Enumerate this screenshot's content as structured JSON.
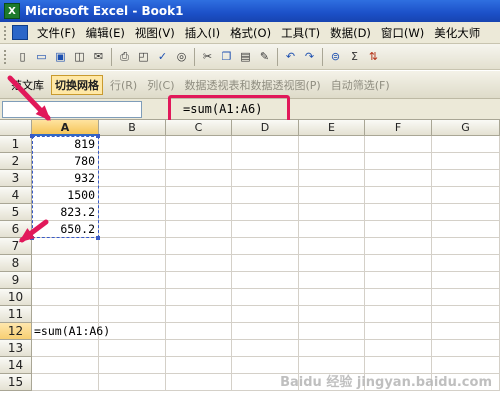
{
  "window": {
    "title": "Microsoft Excel - Book1",
    "app_icon": "X"
  },
  "menubar": {
    "items": [
      "文件(F)",
      "编辑(E)",
      "视图(V)",
      "插入(I)",
      "格式(O)",
      "工具(T)",
      "数据(D)",
      "窗口(W)",
      "美化大师"
    ]
  },
  "toolbar": {
    "icons": [
      "new-icon",
      "open-icon",
      "save-icon",
      "permission-icon",
      "email-icon",
      "print-icon",
      "print-preview-icon",
      "spellcheck-icon",
      "research-icon",
      "cut-icon",
      "copy-icon",
      "paste-icon",
      "format-painter-icon",
      "undo-icon",
      "redo-icon",
      "hyperlink-icon",
      "autosum-icon",
      "sort-icon"
    ]
  },
  "toolbar2": {
    "fanwenku": "范文库",
    "toggle_grid": "切换网格",
    "row": "行(R)",
    "column": "列(C)",
    "pivot": "数据透视表和数据透视图(P)",
    "autofilter": "自动筛选(F)"
  },
  "formula_bar": {
    "name_box": "",
    "content": "=sum(A1:A6)"
  },
  "grid": {
    "columns": [
      "A",
      "B",
      "C",
      "D",
      "E",
      "F",
      "G"
    ],
    "rows": [
      "1",
      "2",
      "3",
      "4",
      "5",
      "6",
      "7",
      "8",
      "9",
      "10",
      "11",
      "12",
      "13",
      "14",
      "15"
    ],
    "values_a": [
      "819",
      "780",
      "932",
      "1500",
      "823.2",
      "650.2"
    ],
    "formula_cell": {
      "ref": "A12",
      "text": "=sum(A1:A6)"
    },
    "selected_column": "A",
    "selected_row": "12"
  },
  "annotation_colors": {
    "highlight": "#e1185a"
  },
  "watermark": "Baidu 经验 jingyan.baidu.com"
}
